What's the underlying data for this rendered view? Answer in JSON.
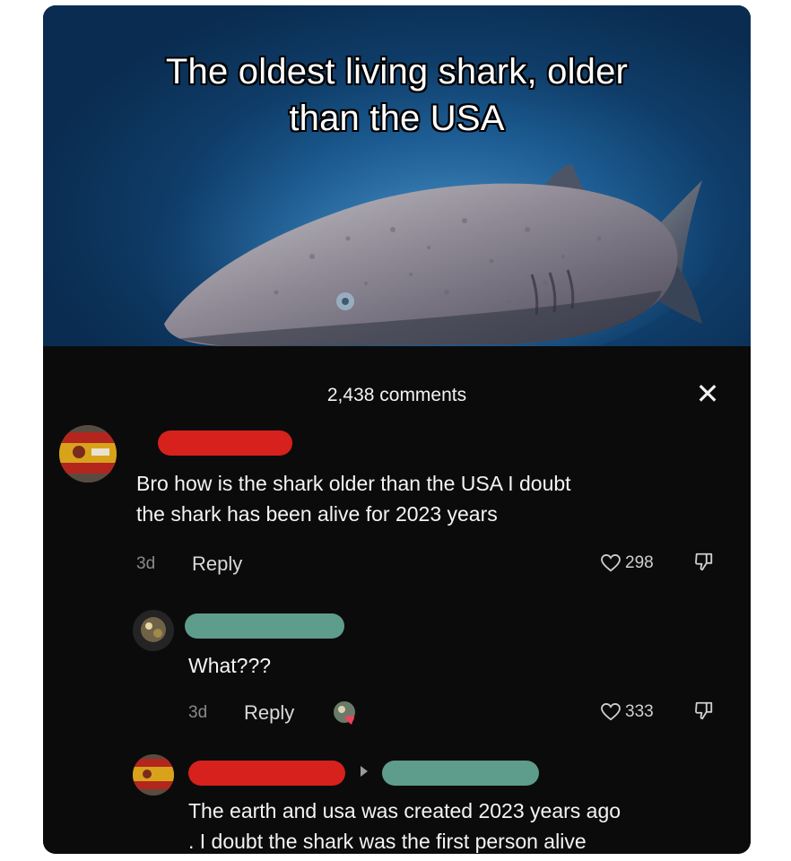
{
  "post": {
    "caption_line1": "The oldest living shark, older",
    "caption_line2": "than the USA"
  },
  "comments_panel": {
    "count_label": "2,438 comments",
    "close_icon": "close-icon"
  },
  "comments": [
    {
      "text_line1": "Bro how is the shark older than the USA I doubt",
      "text_line2": "the shark has been alive for 2023 years",
      "age": "3d",
      "reply_label": "Reply",
      "likes": "298",
      "name_bar_color": "#d6211c"
    },
    {
      "text": "What???",
      "age": "3d",
      "reply_label": "Reply",
      "likes": "333",
      "name_bar_color": "#5e9c8c"
    },
    {
      "text_line1": "The earth and usa was created 2023 years ago",
      "text_line2": ". I doubt the shark was the first person alive",
      "name_bar_color": "#d6211c",
      "reply_to_bar_color": "#5e9c8c"
    }
  ],
  "colors": {
    "panel_bg": "#0b0b0b",
    "text": "#f4f4f4",
    "muted": "#8a8a8a",
    "red_bar": "#d6211c",
    "teal_bar": "#5e9c8c"
  }
}
